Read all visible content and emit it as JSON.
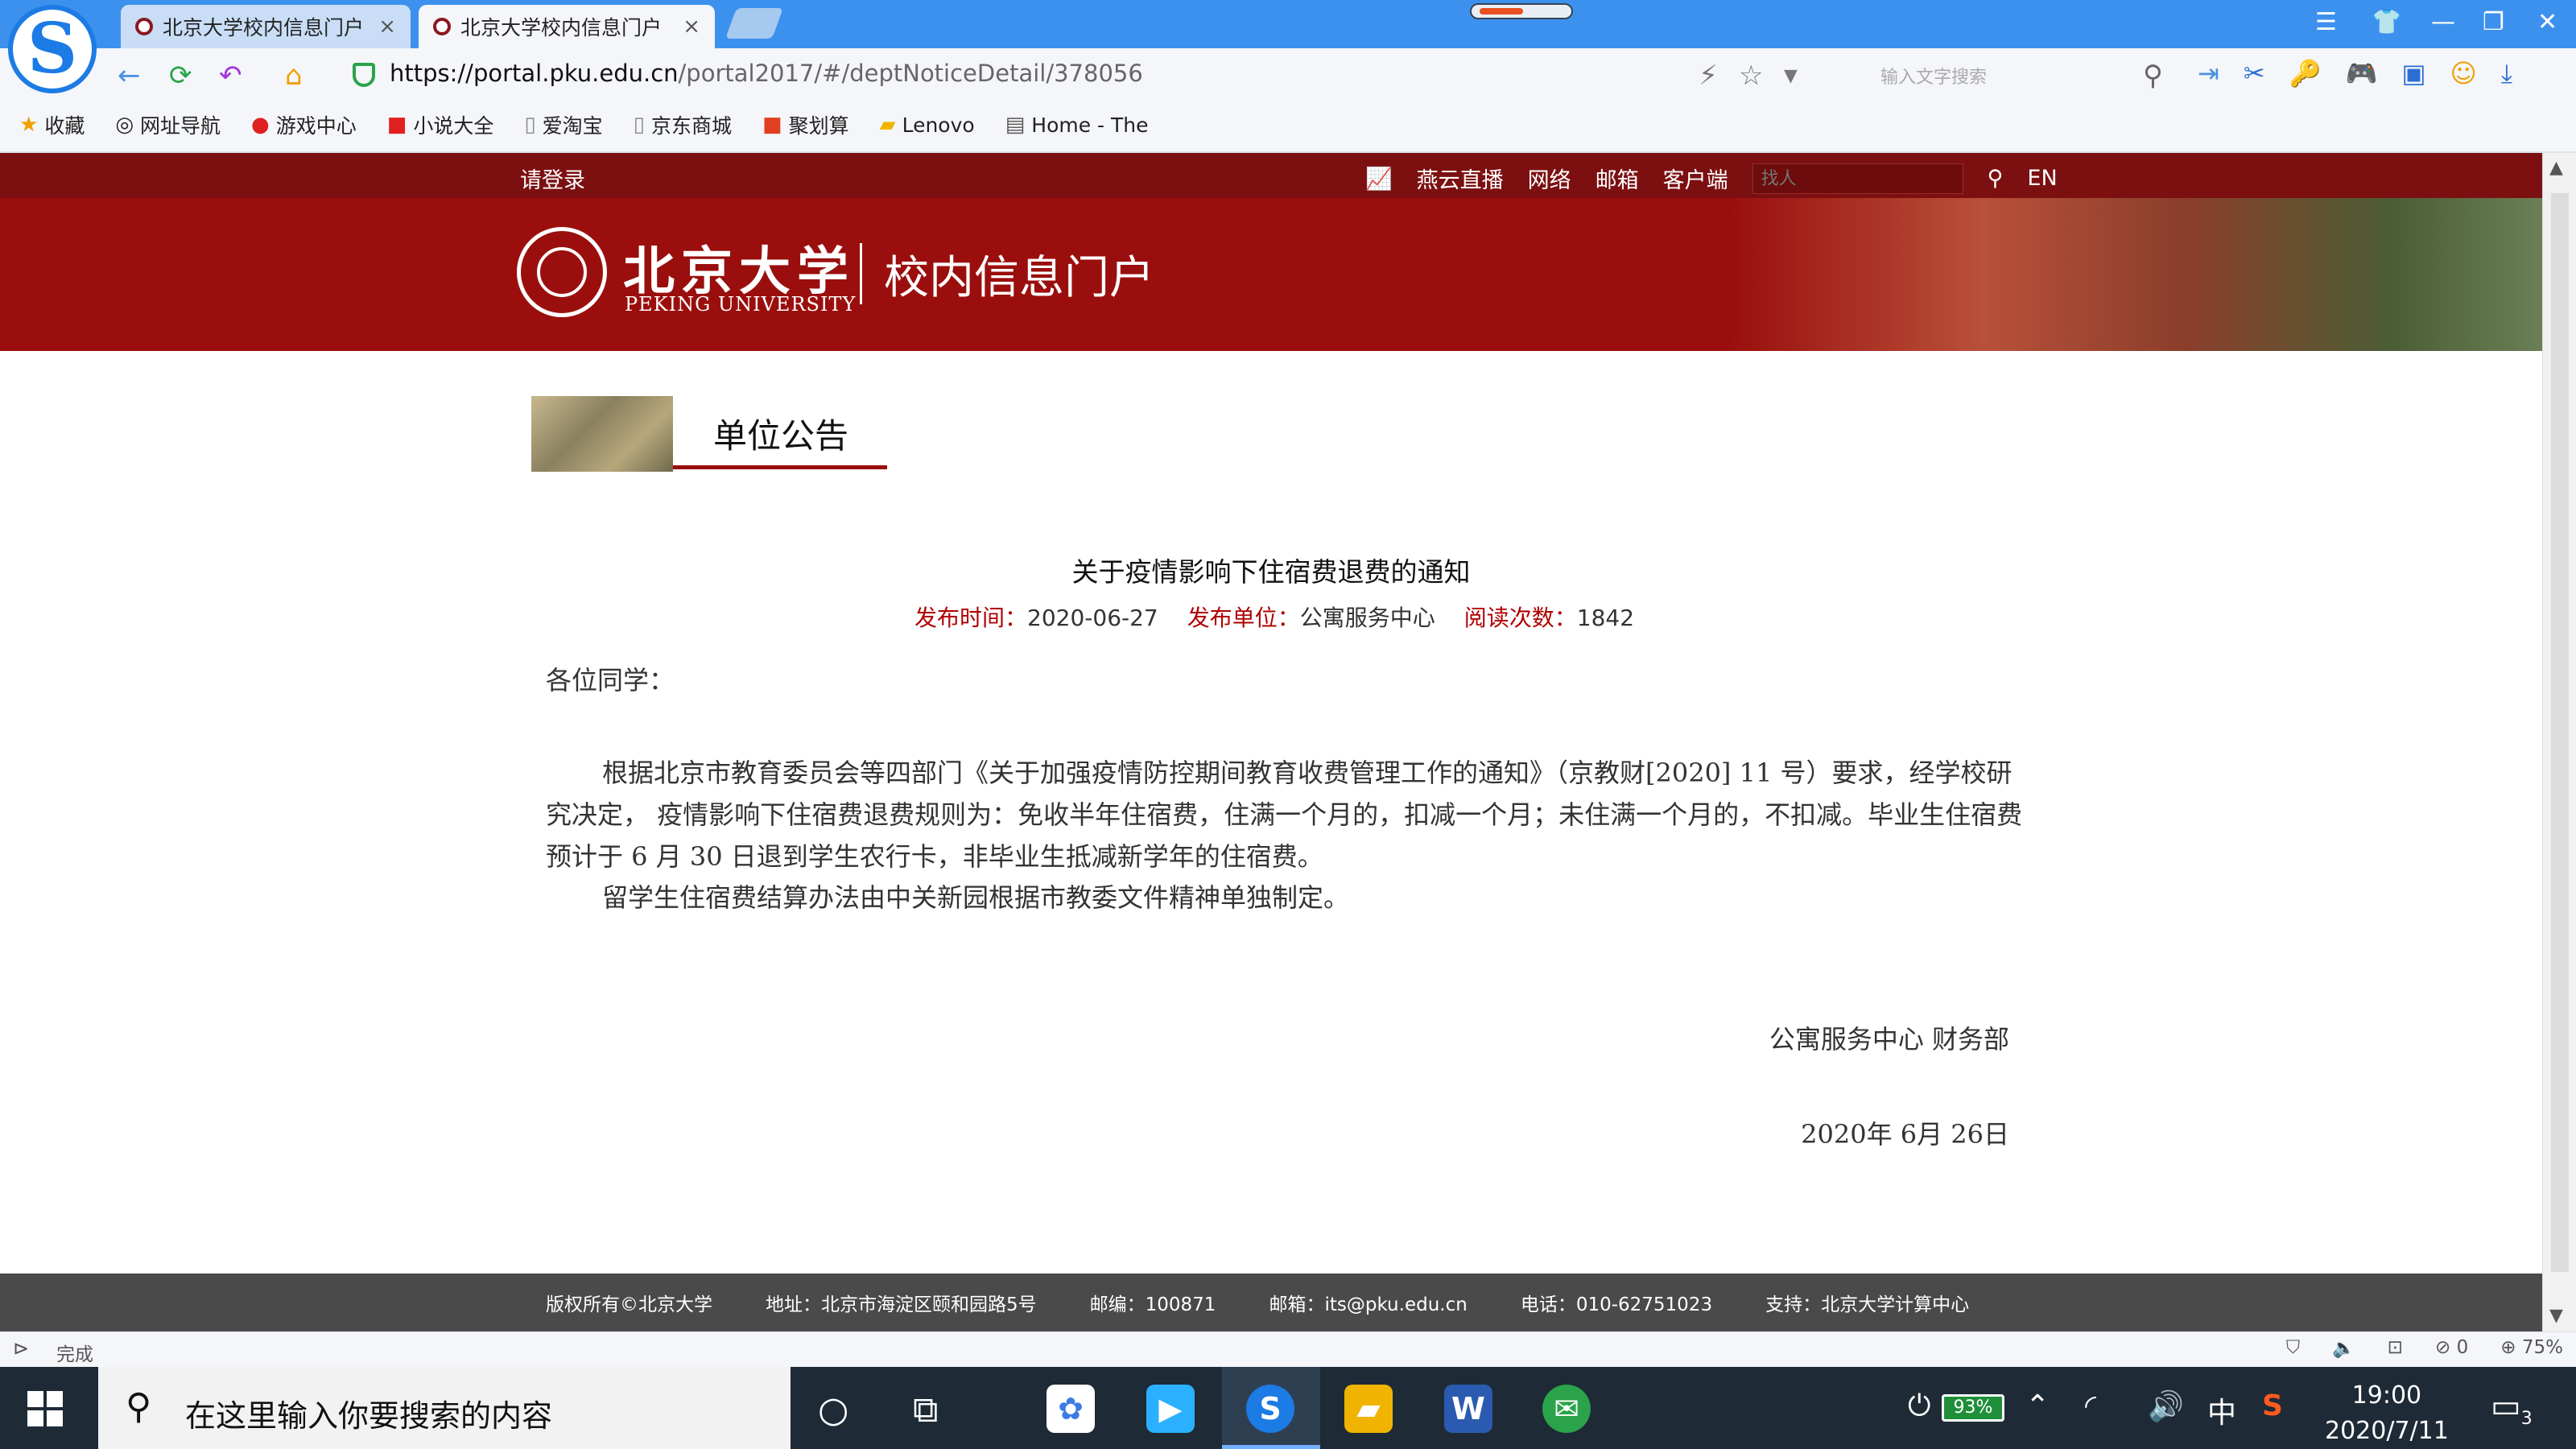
{
  "browser": {
    "tabs": [
      {
        "title": "北京大学校内信息门户",
        "active": false
      },
      {
        "title": "北京大学校内信息门户",
        "active": true
      }
    ],
    "close_glyph": "×",
    "url_prefix": "https://",
    "url_host": "portal.pku.edu.cn",
    "url_path": "/portal2017/#/deptNoticeDetail/378056",
    "search_placeholder": "输入文字搜索",
    "bookmarks": [
      {
        "label": "收藏",
        "icon": "star-icon"
      },
      {
        "label": "网址导航",
        "icon": "globe-icon"
      },
      {
        "label": "游戏中心",
        "icon": "game-icon"
      },
      {
        "label": "小说大全",
        "icon": "book-icon"
      },
      {
        "label": "爱淘宝",
        "icon": "page-icon"
      },
      {
        "label": "京东商城",
        "icon": "page-icon"
      },
      {
        "label": "聚划算",
        "icon": "deal-icon"
      },
      {
        "label": "Lenovo",
        "icon": "folder-icon"
      },
      {
        "label": "Home - The",
        "icon": "page-icon"
      }
    ],
    "status_text": "完成",
    "zoom": "75%",
    "blocked_count": "0"
  },
  "portal": {
    "login": "请登录",
    "nav": [
      "燕云直播",
      "网络",
      "邮箱",
      "客户端"
    ],
    "search_placeholder": "找人",
    "lang": "EN",
    "logo_cn": "北京大学",
    "logo_en": "PEKING UNIVERSITY",
    "portal_title": "校内信息门户",
    "section_title": "单位公告"
  },
  "notice": {
    "title": "关于疫情影响下住宿费退费的通知",
    "meta": [
      {
        "key": "发布时间：",
        "value": "2020-06-27"
      },
      {
        "key": "发布单位：",
        "value": "公寓服务中心"
      },
      {
        "key": "阅读次数：",
        "value": "1842"
      }
    ],
    "greeting": "各位同学：",
    "paragraph1": "根据北京市教育委员会等四部门《关于加强疫情防控期间教育收费管理工作的通知》（京教财[2020] 11 号）要求，经学校研究决定， 疫情影响下住宿费退费规则为：免收半年住宿费，住满一个月的，扣减一个月；未住满一个月的，不扣减。毕业生住宿费预计于 6 月 30 日退到学生农行卡，非毕业生抵减新学年的住宿费。",
    "paragraph2": "留学生住宿费结算办法由中关新园根据市教委文件精神单独制定。",
    "signature": "公寓服务中心  财务部",
    "date": "2020年 6月 26日"
  },
  "footer": [
    "版权所有©北京大学",
    "地址：北京市海淀区颐和园路5号",
    "邮编：100871",
    "邮箱：its@pku.edu.cn",
    "电话：010-62751023",
    "支持：北京大学计算中心"
  ],
  "taskbar": {
    "search_placeholder": "在这里输入你要搜索的内容",
    "battery": "93%",
    "ime": "中",
    "time": "19:00",
    "date": "2020/7/11",
    "notifications": "3"
  }
}
